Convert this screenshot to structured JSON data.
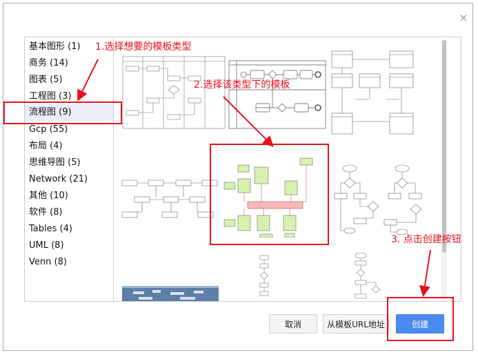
{
  "dialog": {
    "close_glyph": "×"
  },
  "categories": [
    {
      "label": "基本图形 (1)"
    },
    {
      "label": "商务 (14)"
    },
    {
      "label": "图表 (5)"
    },
    {
      "label": "工程图 (3)"
    },
    {
      "label": "流程图 (9)"
    },
    {
      "label": "Gcp (55)"
    },
    {
      "label": "布局 (4)"
    },
    {
      "label": "思维导图 (5)"
    },
    {
      "label": "Network (21)"
    },
    {
      "label": "其他 (10)"
    },
    {
      "label": "软件 (8)"
    },
    {
      "label": "Tables (4)"
    },
    {
      "label": "UML (8)"
    },
    {
      "label": "Venn (8)"
    }
  ],
  "selected_category": "流程图 (9)",
  "buttons": {
    "cancel": "取消",
    "from_url": "从模板URL地址",
    "create": "创建"
  },
  "annotations": {
    "step1": "1.选择想要的模板类型",
    "step2": "2.选择该类型下的模板",
    "step3": "3. 点击创建按钮"
  },
  "colors": {
    "accent_blue": "#4b8bf0",
    "annotation_red": "#e8101a",
    "selected_bg": "#e9eef6"
  }
}
